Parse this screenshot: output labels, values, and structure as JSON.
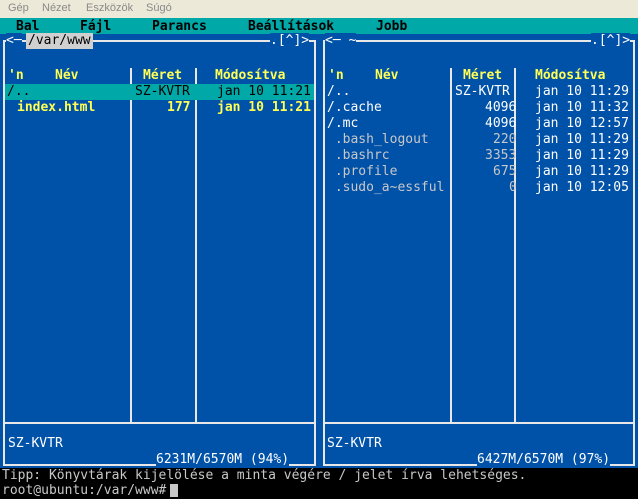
{
  "host_menu": [
    "Gép",
    "Nézet",
    "Eszközök",
    "Súgó"
  ],
  "mc_menu": [
    "Bal",
    "Fájl",
    "Parancs",
    "Beállítások",
    "Jobb"
  ],
  "left_panel": {
    "corner_left": "<─",
    "path": "/var/www",
    "corner_right": ".[^]>",
    "col_sort": "'n",
    "col_name": "Név",
    "col_size": "Méret",
    "col_mtime": "Módosítva",
    "rows": [
      {
        "name": "/..",
        "size": "SZ-KVTR",
        "mtime": "jan 10 11:21",
        "selected": true
      },
      {
        "name": "index.html",
        "size": "177",
        "mtime": "jan 10 11:21",
        "selected": false
      }
    ],
    "status": "SZ-KVTR",
    "disk": "6231M/6570M (94%)"
  },
  "right_panel": {
    "corner_left": "<─ ~",
    "corner_right": ".[^]>",
    "col_sort": "'n",
    "col_name": "Név",
    "col_size": "Méret",
    "col_mtime": "Módosítva",
    "rows": [
      {
        "name": "/..",
        "size": "SZ-KVTR",
        "mtime": "jan 10 11:29"
      },
      {
        "name": "/.cache",
        "size": "4096",
        "mtime": "jan 10 11:32"
      },
      {
        "name": "/.mc",
        "size": "4096",
        "mtime": "jan 10 12:57"
      },
      {
        "name": " .bash_logout",
        "size": "220",
        "mtime": "jan 10 11:29"
      },
      {
        "name": " .bashrc",
        "size": "3353",
        "mtime": "jan 10 11:29"
      },
      {
        "name": " .profile",
        "size": "675",
        "mtime": "jan 10 11:29"
      },
      {
        "name": " .sudo_a~essful",
        "size": "0",
        "mtime": "jan 10 12:05"
      }
    ],
    "status": "SZ-KVTR",
    "disk": "6427M/6570M (97%)"
  },
  "hint": "Tipp: Könyvtárak kijelölése a minta végére / jelet írva lehetséges.",
  "prompt": "root@ubuntu:/var/www#",
  "colors": {
    "panel_bg": "#0051a8",
    "menu_bg": "#00a8a8",
    "selected_bg": "#00a8a8",
    "highlight": "#ffff55"
  }
}
